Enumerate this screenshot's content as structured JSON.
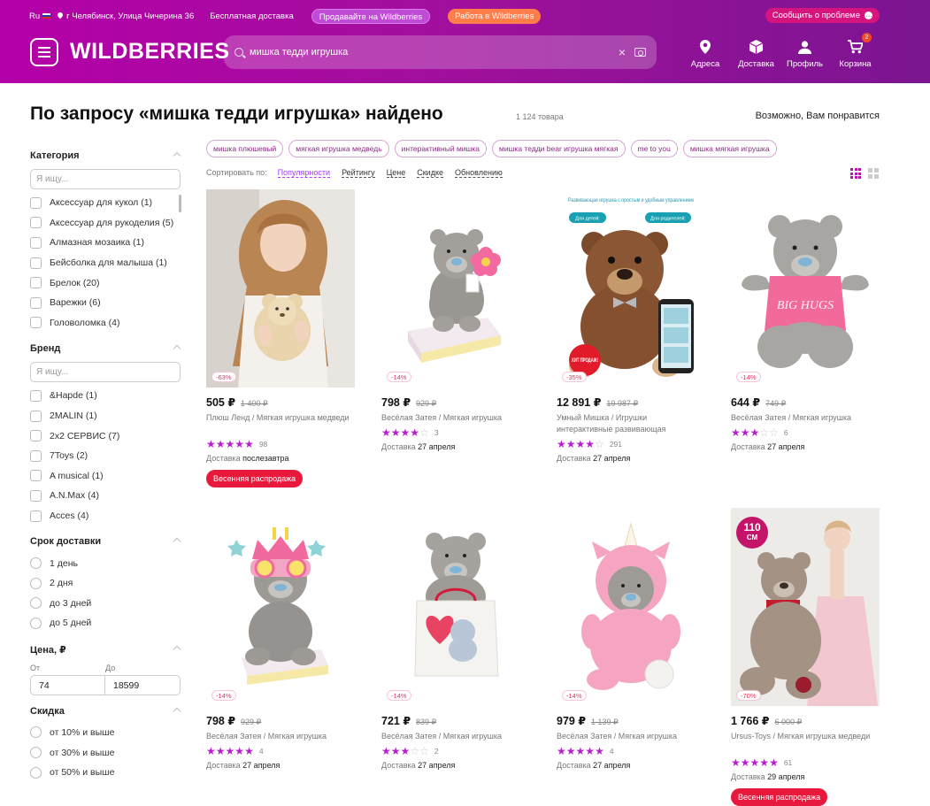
{
  "header": {
    "lang": "Ru",
    "address": "г Челябинск, Улица Чичерина 36",
    "free_delivery": "Бесплатная доставка",
    "sell_label": "Продавайте на Wildberries",
    "work_label": "Работа в Wildberries",
    "report_label": "Сообщить о проблеме",
    "logo": "WILDBERRIES",
    "search_value": "мишка тедди игрушка",
    "nav": [
      {
        "label": "Адреса",
        "icon": "location-icon"
      },
      {
        "label": "Доставка",
        "icon": "box-icon"
      },
      {
        "label": "Профиль",
        "icon": "user-icon"
      },
      {
        "label": "Корзина",
        "icon": "cart-icon",
        "badge": "2"
      }
    ]
  },
  "page": {
    "title": "По запросу «мишка тедди игрушка» найдено",
    "count": "1 124 товара",
    "maybe_like": "Возможно, Вам понравится"
  },
  "tags": [
    "мишка плюшевый",
    "мягкая игрушка медведь",
    "интерактивный мишка",
    "мишка тедди bear игрушка мягкая",
    "me to you",
    "мишка мягкая игрушка"
  ],
  "sort": {
    "label": "Сортировать по:",
    "options": [
      "Популярности",
      "Рейтингу",
      "Цене",
      "Скидке",
      "Обновлению"
    ]
  },
  "filters": {
    "category": {
      "title": "Категория",
      "placeholder": "Я ищу...",
      "items": [
        "Аксессуар для кукол (1)",
        "Аксессуар для рукоделия (5)",
        "Алмазная мозаика (1)",
        "Бейсболка для малыша (1)",
        "Брелок (20)",
        "Варежки (6)",
        "Головоломка (4)"
      ]
    },
    "brand": {
      "title": "Бренд",
      "placeholder": "Я ищу...",
      "items": [
        "&Hapde (1)",
        "2MALIN (1)",
        "2x2 СЕРВИС (7)",
        "7Toys (2)",
        "A musical (1)",
        "A.N.Max (4)",
        "Acces (4)"
      ]
    },
    "delivery": {
      "title": "Срок доставки",
      "items": [
        "1 день",
        "2 дня",
        "до 3 дней",
        "до 5 дней"
      ]
    },
    "price": {
      "title": "Цена, ₽",
      "from_label": "От",
      "to_label": "До",
      "from": "74",
      "to": "18599"
    },
    "discount": {
      "title": "Скидка",
      "items": [
        "от 10% и выше",
        "от 30% и выше",
        "от 50% и выше"
      ]
    }
  },
  "products": [
    {
      "discount": "-63%",
      "price": "505 ₽",
      "old": "1 400 ₽",
      "brand": "Плюш Ленд / Мягкая игрушка медведи",
      "stars": 5,
      "reviews": "98",
      "delivery_label": "Доставка",
      "delivery": "послезавтра",
      "promo": "Весенняя распродажа"
    },
    {
      "discount": "-14%",
      "price": "798 ₽",
      "old": "929 ₽",
      "brand": "Весёлая Затея / Мягкая игрушка",
      "stars": 4,
      "reviews": "3",
      "delivery_label": "Доставка",
      "delivery": "27 апреля"
    },
    {
      "discount": "-35%",
      "price": "12 891 ₽",
      "old": "19 987 ₽",
      "brand": "Умный Мишка / Игрушки интерактивные развивающая",
      "stars": 4,
      "reviews": "291",
      "delivery_label": "Доставка",
      "delivery": "27 апреля",
      "img_text": {
        "head": "Развивающая игрушка с простым и удобным управлением",
        "a": "Для детей:",
        "b": "Для родителей:",
        "hit": "ХИТ ПРОДАЖ!"
      }
    },
    {
      "discount": "-14%",
      "price": "644 ₽",
      "old": "749 ₽",
      "brand": "Весёлая Затея / Мягкая игрушка",
      "stars": 3,
      "reviews": "6",
      "delivery_label": "Доставка",
      "delivery": "27 апреля",
      "img_text": {
        "shirt": "BIG HUGS"
      }
    },
    {
      "discount": "-14%",
      "price": "798 ₽",
      "old": "929 ₽",
      "brand": "Весёлая Затея / Мягкая игрушка",
      "stars": 5,
      "reviews": "4",
      "delivery_label": "Доставка",
      "delivery": "27 апреля"
    },
    {
      "discount": "-14%",
      "price": "721 ₽",
      "old": "839 ₽",
      "brand": "Весёлая Затея / Мягкая игрушка",
      "stars": 3,
      "reviews": "2",
      "delivery_label": "Доставка",
      "delivery": "27 апреля"
    },
    {
      "discount": "-14%",
      "price": "979 ₽",
      "old": "1 139 ₽",
      "brand": "Весёлая Затея / Мягкая игрушка",
      "stars": 5,
      "reviews": "4",
      "delivery_label": "Доставка",
      "delivery": "27 апреля"
    },
    {
      "discount": "-70%",
      "price": "1 766 ₽",
      "old": "6 000 ₽",
      "brand": "Ursus-Toys / Мягкая игрушка медведи",
      "stars": 5,
      "reviews": "61",
      "delivery_label": "Доставка",
      "delivery": "29 апреля",
      "promo": "Весенняя распродажа",
      "img_text": {
        "size": "110",
        "unit": "СМ"
      }
    }
  ],
  "colors": {
    "accent": "#a73afd",
    "header": "#a30f9e",
    "star": "#b81ed0",
    "promo": "#e8193c"
  }
}
